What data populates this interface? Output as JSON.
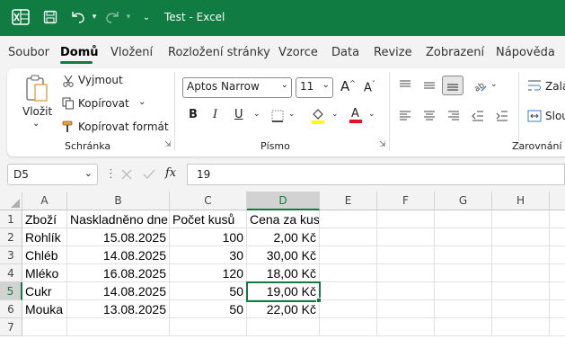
{
  "titlebar": {
    "title": "Test  -  Excel",
    "bg": "#107c41"
  },
  "tabs": [
    "Soubor",
    "Domů",
    "Vložení",
    "Rozložení stránky",
    "Vzorce",
    "Data",
    "Revize",
    "Zobrazení",
    "Nápověda"
  ],
  "active_tab": "Domů",
  "ribbon": {
    "paste_label": "Vložit",
    "cut_label": "Vyjmout",
    "copy_label": "Kopírovat",
    "format_painter_label": "Kopírovat formát",
    "clipboard_group": "Schránka",
    "font_name": "Aptos Narrow",
    "font_size": "11",
    "grow_font": "A",
    "shrink_font": "A",
    "bold": "B",
    "italic": "I",
    "underline": "U",
    "font_color_glyph": "A",
    "font_group": "Písmo",
    "wrap_label": "Zala",
    "merge_label": "Slou",
    "alignment_group": "Zarovnání",
    "fill_color": "#ffff00",
    "font_color": "#e81123"
  },
  "formula_bar": {
    "name_box": "D5",
    "fx": "fx",
    "value": "19"
  },
  "sheet": {
    "columns": [
      "A",
      "B",
      "C",
      "D",
      "E",
      "F",
      "G",
      "H"
    ],
    "selected_column": "D",
    "selected_row": "5",
    "row_numbers": [
      "1",
      "2",
      "3",
      "4",
      "5",
      "6",
      "7"
    ],
    "rows": [
      [
        "Zboží",
        "Naskladněno dne",
        "Počet kusů",
        "Cena za kus"
      ],
      [
        "Rohlík",
        "15.08.2025",
        "100",
        "2,00 Kč"
      ],
      [
        "Chléb",
        "14.08.2025",
        "30",
        "30,00 Kč"
      ],
      [
        "Mléko",
        "16.08.2025",
        "120",
        "18,00 Kč"
      ],
      [
        "Cukr",
        "14.08.2025",
        "50",
        "19,00 Kč"
      ],
      [
        "Mouka",
        "13.08.2025",
        "50",
        "22,00 Kč"
      ]
    ]
  }
}
